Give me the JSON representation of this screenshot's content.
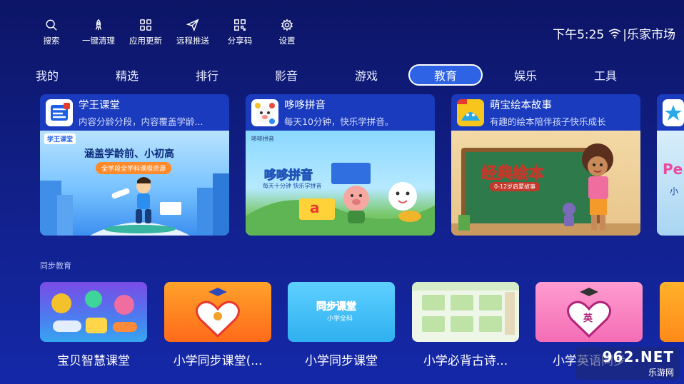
{
  "toolbar": {
    "search": "搜索",
    "clean": "一键清理",
    "update": "应用更新",
    "push": "远程推送",
    "share": "分享码",
    "settings": "设置"
  },
  "status": {
    "time": "下午5:25",
    "market": "|乐家市场"
  },
  "tabs": [
    "我的",
    "精选",
    "排行",
    "影音",
    "游戏",
    "教育",
    "娱乐",
    "工具"
  ],
  "active_tab": "教育",
  "featured": [
    {
      "title": "学王课堂",
      "desc": "内容分龄分段，内容覆盖学龄...",
      "banner_logo": "学王课堂",
      "banner_headline": "涵盖学龄前、小初高",
      "banner_sub": "全学段全学科课程资源"
    },
    {
      "title": "哆哆拼音",
      "desc": "每天10分钟，快乐学拼音。",
      "banner_logo": "哆哆拼音",
      "banner_headline": "哆哆拼音",
      "banner_sub": "每天十分钟 快乐学拼音",
      "banner_letter": "a"
    },
    {
      "title": "萌宝绘本故事",
      "desc": "有趣的绘本陪伴孩子快乐成长",
      "banner_headline": "经典绘本",
      "banner_sub": "0-12岁启蒙故事"
    },
    {
      "title": "",
      "desc": "",
      "banner_headline": "Pe",
      "banner_sub": "小"
    }
  ],
  "section": {
    "label": "同步教育",
    "items": [
      {
        "name": "宝贝智慧课堂"
      },
      {
        "name": "小学同步课堂(..."
      },
      {
        "name": "小学同步课堂",
        "thumb_text": "同步课堂",
        "thumb_sub": "小学全科"
      },
      {
        "name": "小学必背古诗..."
      },
      {
        "name": "小学英语同步",
        "thumb_badge": "英"
      },
      {
        "name": ""
      }
    ]
  },
  "watermark": {
    "brand": "962.NET",
    "sub": "乐游网"
  }
}
